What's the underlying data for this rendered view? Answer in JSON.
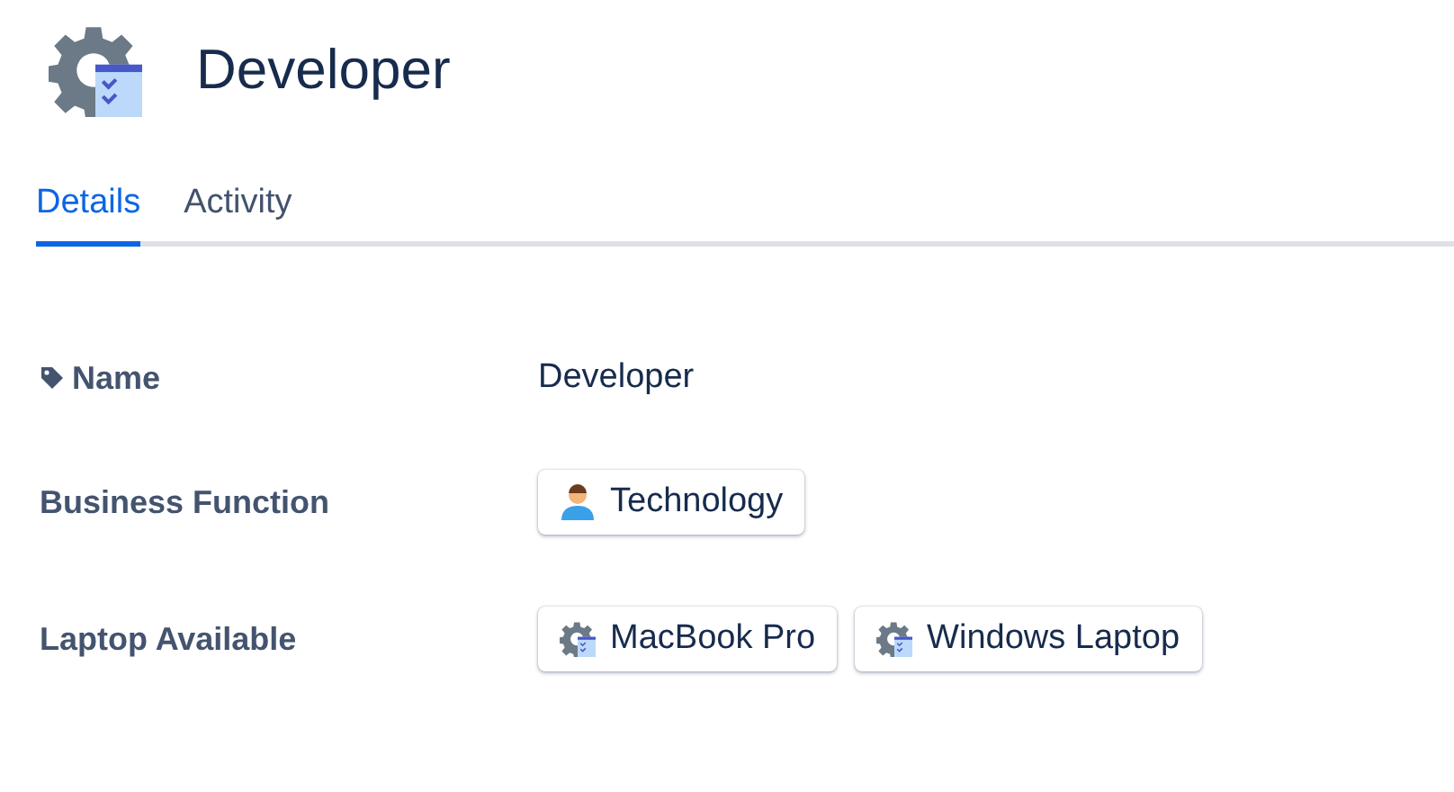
{
  "title": "Developer",
  "tabs": [
    {
      "label": "Details",
      "selected": true
    },
    {
      "label": "Activity",
      "selected": false
    }
  ],
  "fields": [
    {
      "kind": "text",
      "label": "Name",
      "value": "Developer"
    },
    {
      "kind": "function",
      "label": "Business Function",
      "chips": [
        "Technology"
      ]
    },
    {
      "kind": "asset",
      "label": "Laptop Available",
      "chips": [
        "MacBook Pro",
        "Windows Laptop"
      ]
    }
  ]
}
